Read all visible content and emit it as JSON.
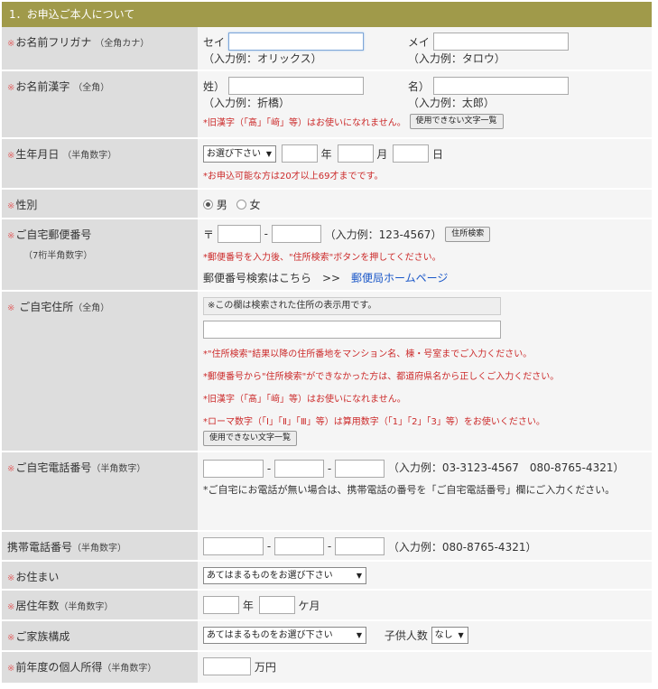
{
  "section_title": "1．お申込ご本人について",
  "req_mark": "※",
  "furigana": {
    "label": "お名前フリガナ",
    "sub": "（全角カナ）",
    "sei": "セイ",
    "mei": "メイ",
    "sei_example": "（入力例：オリックス）",
    "mei_example": "（入力例：タロウ）"
  },
  "kanji": {
    "label": "お名前漢字",
    "sub": "（全角）",
    "sei": "姓）",
    "mei": "名）",
    "sei_example": "（入力例：折橋）",
    "mei_example": "（入力例：太郎）",
    "note": "*旧漢字（「髙」「﨑」等）はお使いになれません。",
    "button": "使用できない文字一覧"
  },
  "birth": {
    "label": "生年月日",
    "sub": "（半角数字）",
    "select": "お選び下さい",
    "year": "年",
    "month": "月",
    "day": "日",
    "note": "*お申込可能な方は20才以上69才までです。"
  },
  "gender": {
    "label": "性別",
    "male": "男",
    "female": "女"
  },
  "zip": {
    "label": "ご自宅郵便番号",
    "sub": "（7桁半角数字）",
    "mark": "〒",
    "dash": "-",
    "example": "（入力例：123-4567）",
    "button": "住所検索",
    "note": "*郵便番号を入力後、\"住所検索\"ボタンを押してください。",
    "search_text": "郵便番号検索はこちら　>>",
    "search_link": "郵便局ホームページ"
  },
  "address": {
    "label": "ご自宅住所",
    "sub": "（全角）",
    "display_text": "※この欄は検索された住所の表示用です。",
    "note1": "*\"住所検索\"結果以降の住所番地をマンション名、棟・号室までご入力ください。",
    "note2": "*郵便番号から\"住所検索\"ができなかった方は、都道府県名から正しくご入力ください。",
    "note3": "*旧漢字（「髙」「﨑」等）はお使いになれません。",
    "note4": "*ローマ数字（「Ⅰ」「Ⅱ」「Ⅲ」等）は算用数字（「1」「2」「3」等）をお使いください。",
    "button": "使用できない文字一覧"
  },
  "home_tel": {
    "label": "ご自宅電話番号",
    "sub": "（半角数字）",
    "dash": "-",
    "example": "（入力例：03-3123-4567　080-8765-4321）",
    "note": "*ご自宅にお電話が無い場合は、携帯電話の番号を「ご自宅電話番号」欄にご入力ください。"
  },
  "mobile_tel": {
    "label": "携帯電話番号",
    "sub": "（半角数字）",
    "dash": "-",
    "example": "（入力例：080-8765-4321）"
  },
  "residence": {
    "label": "お住まい",
    "select": "あてはまるものをお選び下さい"
  },
  "years": {
    "label": "居住年数",
    "sub": "（半角数字）",
    "year": "年",
    "month": "ケ月"
  },
  "family": {
    "label": "ご家族構成",
    "select": "あてはまるものをお選び下さい",
    "children_label": "子供人数",
    "children_select": "なし"
  },
  "income": {
    "label": "前年度の個人所得",
    "sub": "（半角数字）",
    "unit": "万円"
  }
}
